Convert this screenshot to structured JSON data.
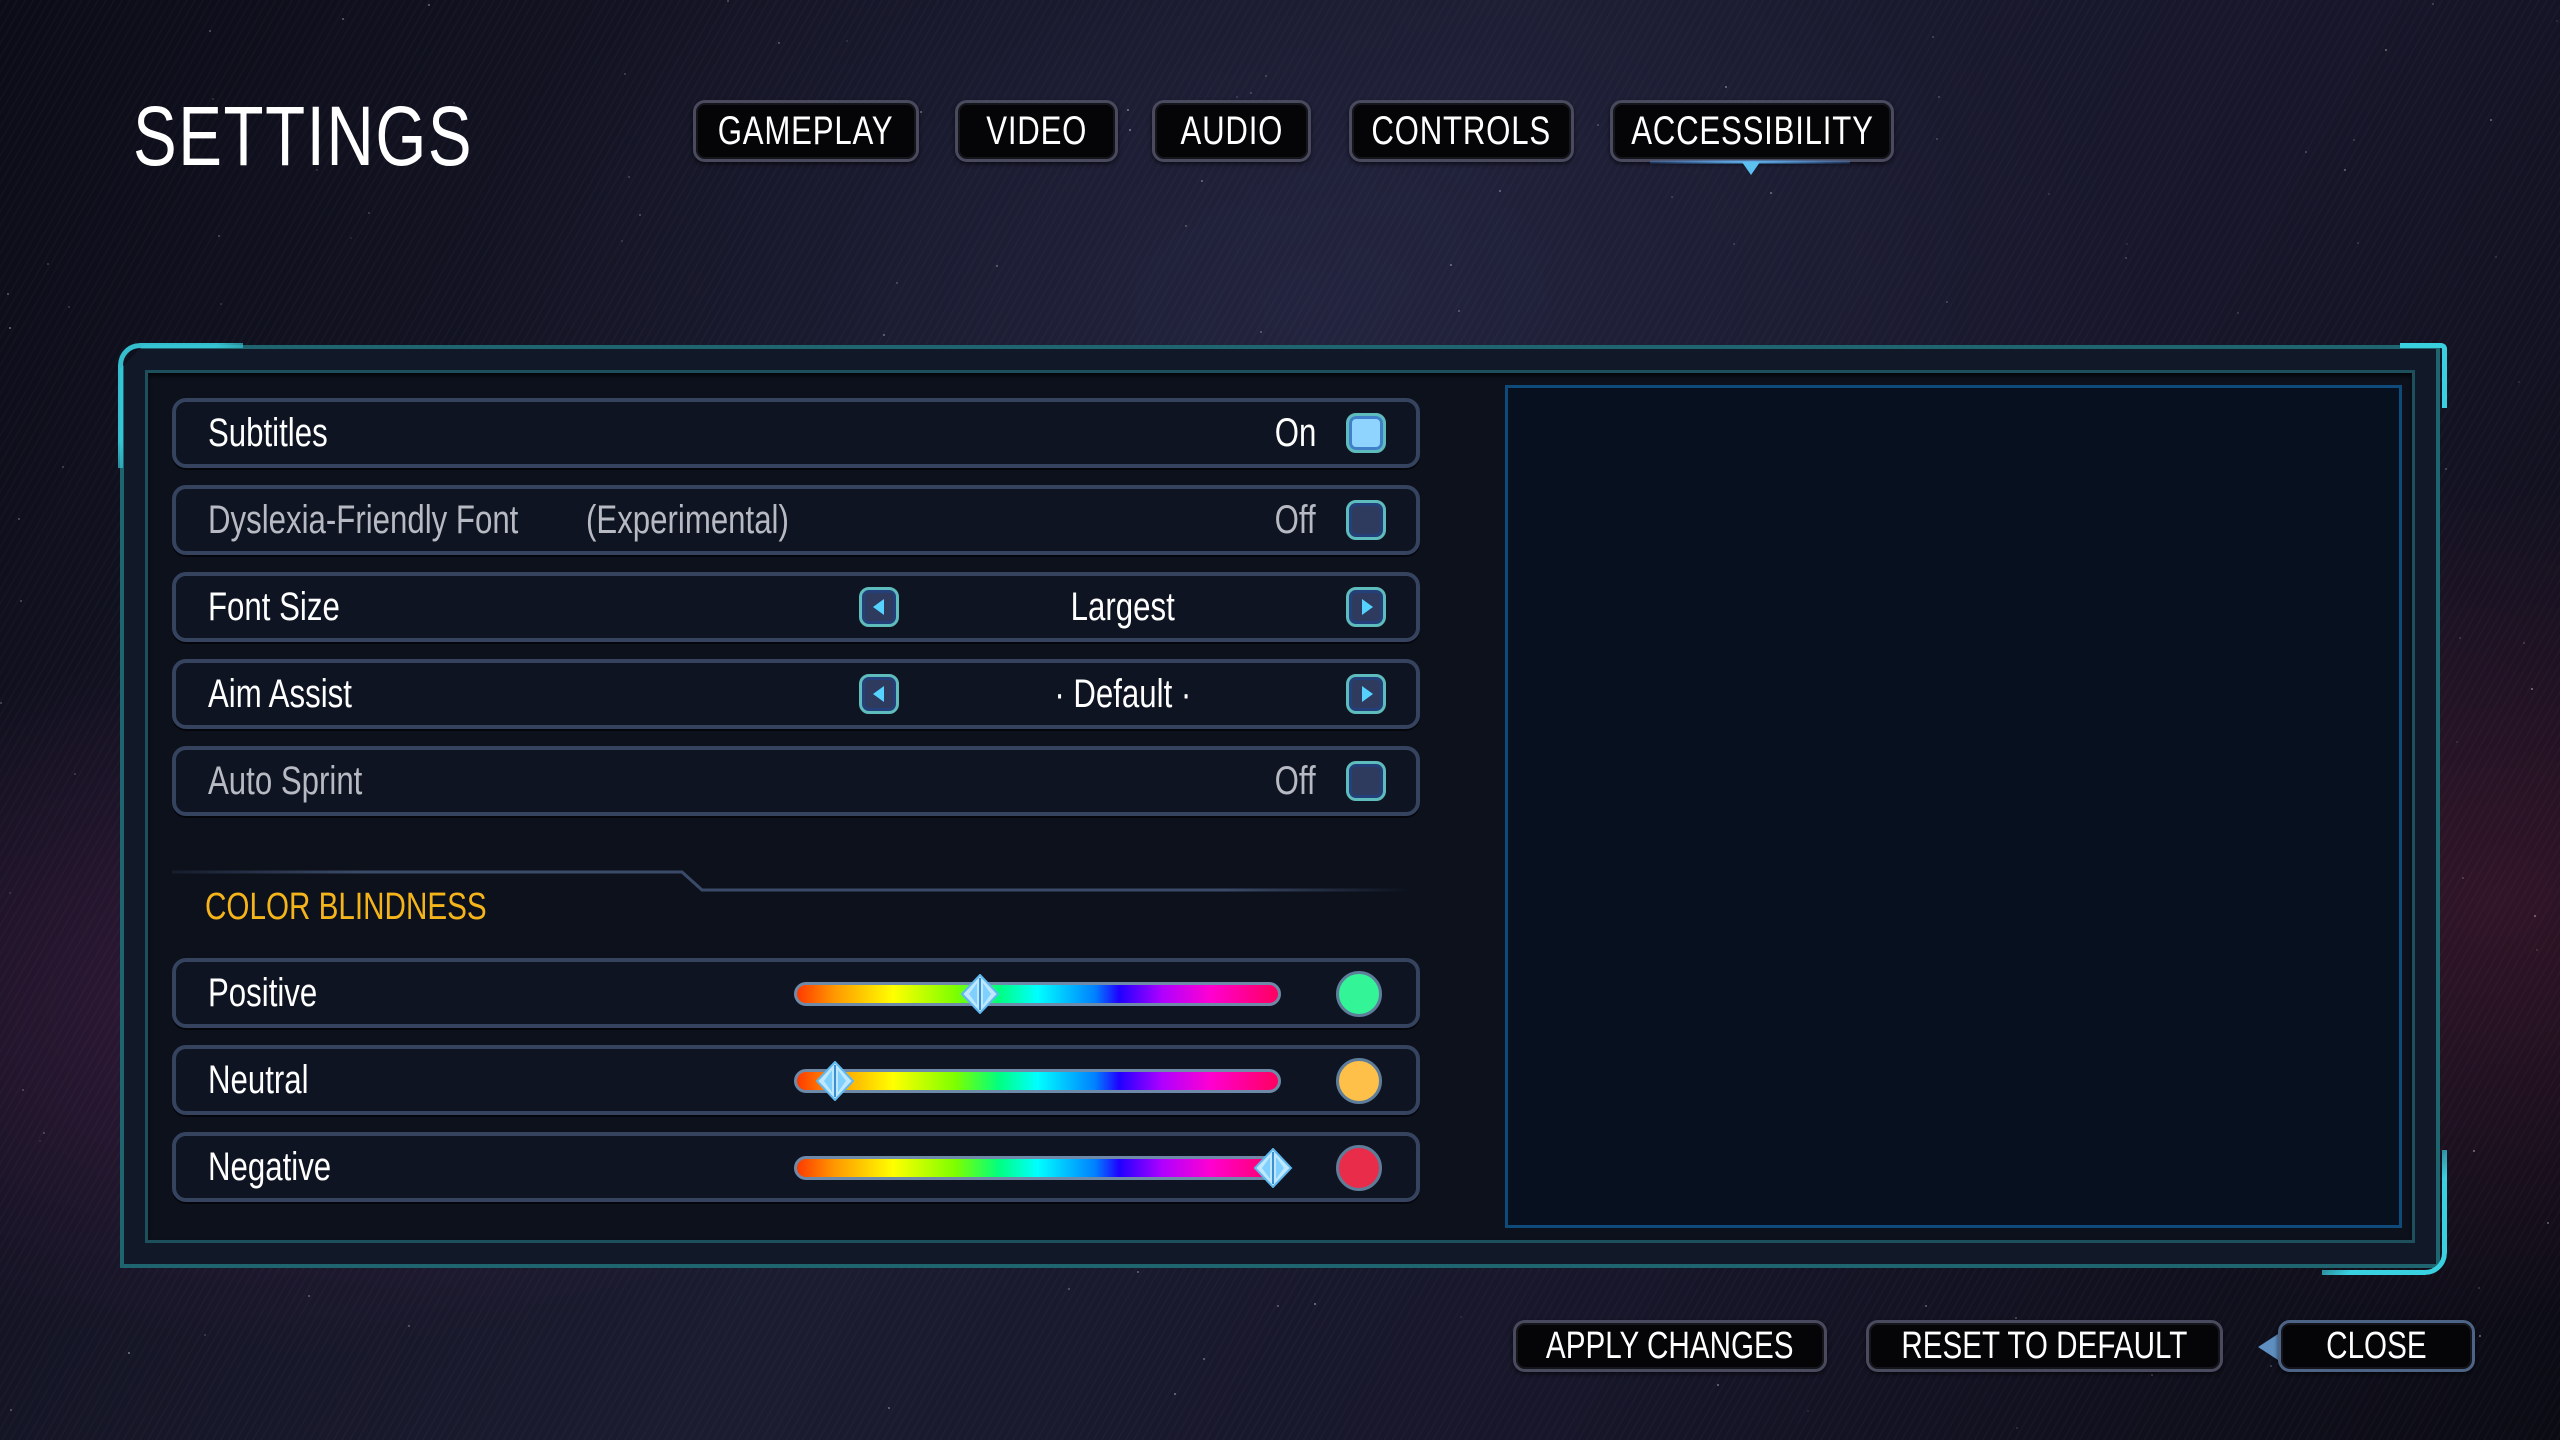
{
  "header": {
    "title": "SETTINGS"
  },
  "tabs": [
    {
      "label": "GAMEPLAY",
      "active": false
    },
    {
      "label": "VIDEO",
      "active": false
    },
    {
      "label": "AUDIO",
      "active": false
    },
    {
      "label": "CONTROLS",
      "active": false
    },
    {
      "label": "ACCESSIBILITY",
      "active": true
    }
  ],
  "settings": {
    "subtitles": {
      "label": "Subtitles",
      "value": "On",
      "checked": true
    },
    "dyslexia_font": {
      "label": "Dyslexia-Friendly Font",
      "note": "(Experimental)",
      "value": "Off",
      "checked": false
    },
    "font_size": {
      "label": "Font Size",
      "value": "Largest"
    },
    "aim_assist": {
      "label": "Aim Assist",
      "value": "· Default ·"
    },
    "auto_sprint": {
      "label": "Auto Sprint",
      "value": "Off",
      "checked": false
    }
  },
  "color_blindness": {
    "title": "COLOR BLINDNESS",
    "items": [
      {
        "label": "Positive",
        "slider_fraction": 0.38,
        "swatch_color": "#33f598"
      },
      {
        "label": "Neutral",
        "slider_fraction": 0.08,
        "swatch_color": "#ffc04a"
      },
      {
        "label": "Negative",
        "slider_fraction": 0.99,
        "swatch_color": "#e82c4a"
      }
    ]
  },
  "footer": {
    "apply_label": "APPLY CHANGES",
    "reset_label": "RESET TO DEFAULT",
    "close_label": "CLOSE"
  },
  "colors": {
    "accent_cyan": "#39d0e0",
    "section_title": "#f5b51a",
    "checkbox_on": "#8ed4ff"
  }
}
